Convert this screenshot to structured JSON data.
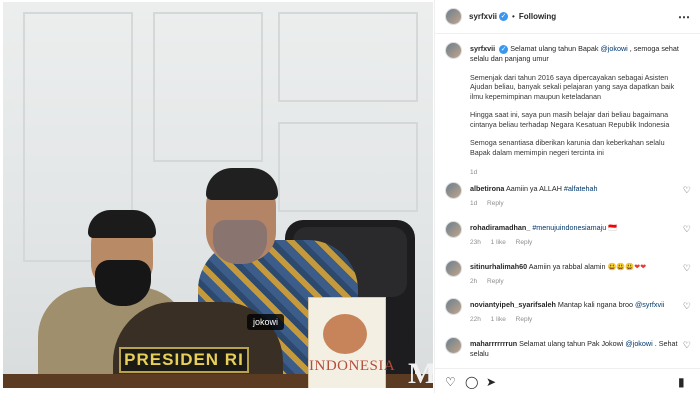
{
  "post": {
    "photo_tag": "jokowi",
    "nameplate": "PRESIDEN RI",
    "calendar_text": "INDONESIA",
    "logo_letter": "M"
  },
  "header": {
    "username": "syrfxvii",
    "separator": "•",
    "follow_status": "Following",
    "more_icon": "⋯"
  },
  "caption": {
    "username": "syrfxvii",
    "line1_pre": "Selamat ulang tahun Bapak ",
    "line1_mention": "@jokowi",
    "line1_post": " , semoga sehat selalu dan panjang umur",
    "para2": "Semenjak dari tahun 2016 saya dipercayakan sebagai Asisten Ajudan beliau, banyak sekali pelajaran yang saya dapatkan baik ilmu kepemimpinan maupun keteladanan",
    "para3": "Hingga saat ini, saya pun masih belajar dari beliau bagaimana cintanya beliau terhadap Negara Kesatuan Republik Indonesia",
    "para4": "Semoga senantiasa diberikan karunia dan keberkahan selalu Bapak dalam memimpin negeri tercinta ini",
    "time": "1d"
  },
  "comments": [
    {
      "user": "albetirona",
      "pre": "Aamiin ya ALLAH ",
      "mention": "#alfatehah",
      "post": "",
      "time": "1d",
      "likes": "",
      "reply": "Reply"
    },
    {
      "user": "rohadiramadhan_",
      "pre": "",
      "mention": "#menujuindonesiamaju",
      "post": " 🇮🇩",
      "time": "23h",
      "likes": "1 like",
      "reply": "Reply"
    },
    {
      "user": "sitinurhalimah60",
      "pre": "Aamiin ya rabbal alamin ",
      "mention": "",
      "post": "😃😃😃❤❤",
      "time": "2h",
      "likes": "",
      "reply": "Reply"
    },
    {
      "user": "noviantyipeh_syarifsaleh",
      "pre": "Mantap kali ngana broo ",
      "mention": "@syrfxvii",
      "post": "",
      "time": "22h",
      "likes": "1 like",
      "reply": "Reply"
    },
    {
      "user": "maharrrrrrrun",
      "pre": "Selamat ulang tahun Pak Jokowi ",
      "mention": "@jokowi",
      "post": " . Sehat selalu",
      "time": "",
      "likes": "",
      "reply": ""
    }
  ],
  "icons": {
    "heart": "♡",
    "like": "♡",
    "comment": "◯",
    "share": "➤",
    "save": "▮"
  }
}
